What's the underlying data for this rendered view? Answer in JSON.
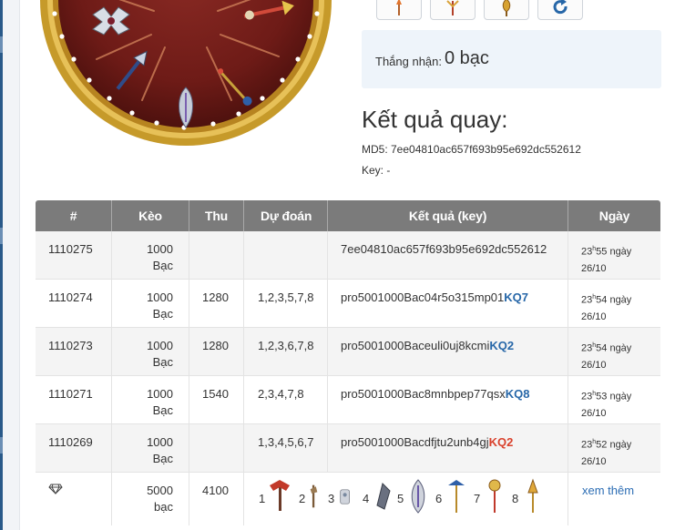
{
  "theme": {
    "header_bg": "#7b7b7b",
    "link_color": "#2c6db4",
    "kq_blue": "#2767a8",
    "kq_red": "#d9412c",
    "reward_bg": "#eef4fa"
  },
  "wheel": {
    "segment_icons": [
      "axe-weapon-icon",
      "spear-weapon-icon",
      "sword-weapon-icon",
      "blade-weapon-icon",
      "scepter-weapon-icon"
    ]
  },
  "top_buttons": [
    {
      "icon": "torch-icon"
    },
    {
      "icon": "staff-icon"
    },
    {
      "icon": "trident-icon"
    },
    {
      "icon": "refresh-icon"
    }
  ],
  "reward": {
    "label": "Thắng nhận:",
    "value": "0 bạc"
  },
  "result": {
    "title": "Kết quả quay:",
    "md5": "MD5: 7ee04810ac657f693b95e692dc552612",
    "key": "Key: -"
  },
  "table": {
    "headers": [
      "#",
      "Kèo",
      "Thu",
      "Dự đoán",
      "Kết quả (key)",
      "Ngày"
    ],
    "rows": [
      {
        "id": "1110275",
        "keo_1": "1000",
        "keo_2": "Bạc",
        "thu": "",
        "du_doan": "",
        "ket_qua": "7ee04810ac657f693b95e692dc552612",
        "kq": "",
        "kq_color": "",
        "time": "23",
        "time_sup": "h",
        "time_rest": "55 ngày",
        "date": "26/10"
      },
      {
        "id": "1110274",
        "keo_1": "1000",
        "keo_2": "Bạc",
        "thu": "1280",
        "du_doan": "1,2,3,5,7,8",
        "ket_qua": "pro5001000Bac04r5o315mp01",
        "kq": "KQ7",
        "kq_color": "blue",
        "time": "23",
        "time_sup": "h",
        "time_rest": "54 ngày",
        "date": "26/10"
      },
      {
        "id": "1110273",
        "keo_1": "1000",
        "keo_2": "Bạc",
        "thu": "1280",
        "du_doan": "1,2,3,6,7,8",
        "ket_qua": "pro5001000Baceuli0uj8kcmi",
        "kq": "KQ2",
        "kq_color": "blue",
        "time": "23",
        "time_sup": "h",
        "time_rest": "54 ngày",
        "date": "26/10"
      },
      {
        "id": "1110271",
        "keo_1": "1000",
        "keo_2": "Bạc",
        "thu": "1540",
        "du_doan": "2,3,4,7,8",
        "ket_qua": "pro5001000Bac8mnbpep77qsx",
        "kq": "KQ8",
        "kq_color": "blue",
        "time": "23",
        "time_sup": "h",
        "time_rest": "53 ngày",
        "date": "26/10"
      },
      {
        "id": "1110269",
        "keo_1": "1000",
        "keo_2": "Bạc",
        "thu": "",
        "du_doan": "1,3,4,5,6,7",
        "ket_qua": "pro5001000Bacdfjtu2unb4gj",
        "kq": "KQ2",
        "kq_color": "red",
        "time": "23",
        "time_sup": "h",
        "time_rest": "52 ngày",
        "date": "26/10"
      }
    ],
    "footer": {
      "icon": "diamond-icon",
      "keo_1": "5000",
      "keo_2": "bạc",
      "thu": "4100",
      "items": [
        {
          "n": "1",
          "icon": "axe-weapon-icon"
        },
        {
          "n": "2",
          "icon": "hammer-weapon-icon"
        },
        {
          "n": "3",
          "icon": "staff-weapon-icon"
        },
        {
          "n": "4",
          "icon": "blade-weapon-icon"
        },
        {
          "n": "5",
          "icon": "sword-weapon-icon"
        },
        {
          "n": "6",
          "icon": "scepter-weapon-icon"
        },
        {
          "n": "7",
          "icon": "mace-weapon-icon"
        },
        {
          "n": "8",
          "icon": "spear-weapon-icon"
        }
      ],
      "link": "xem thêm"
    }
  }
}
